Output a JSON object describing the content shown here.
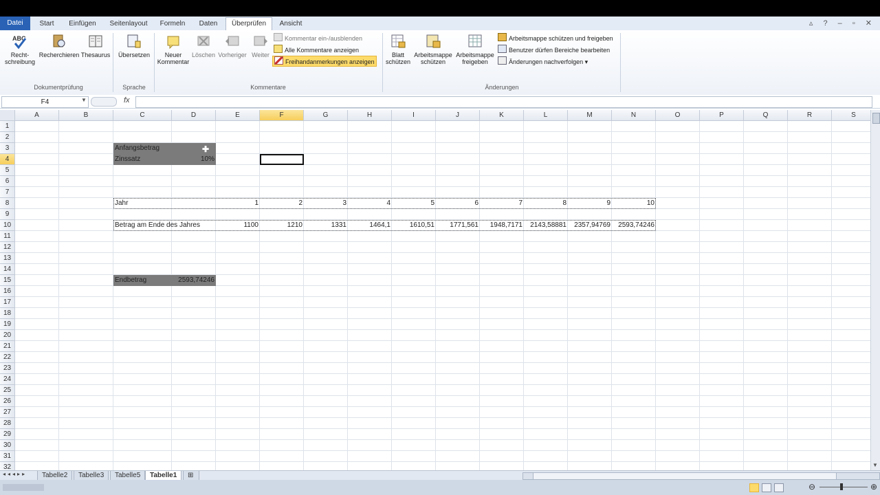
{
  "tabs": [
    "Datei",
    "Start",
    "Einfügen",
    "Seitenlayout",
    "Formeln",
    "Daten",
    "Überprüfen",
    "Ansicht"
  ],
  "ribbon": {
    "proof": {
      "spell": "Recht-\nschreibung",
      "research": "Recherchieren",
      "thesaurus": "Thesaurus",
      "group": "Dokumentprüfung"
    },
    "language": {
      "translate": "Übersetzen",
      "group": "Sprache"
    },
    "comments": {
      "new": "Neuer\nKommentar",
      "delete": "Löschen",
      "prev": "Vorheriger",
      "next": "Weiter",
      "toggle": "Kommentar ein-/ausblenden",
      "showall": "Alle Kommentare anzeigen",
      "ink": "Freihandanmerkungen anzeigen",
      "group": "Kommentare"
    },
    "changes": {
      "protect_sheet": "Blatt\nschützen",
      "protect_wb": "Arbeitsmappe\nschützen",
      "share_wb": "Arbeitsmappe\nfreigeben",
      "protect_share": "Arbeitsmappe schützen und freigeben",
      "allow_ranges": "Benutzer dürfen Bereiche bearbeiten",
      "track": "Änderungen nachverfolgen ▾",
      "group": "Änderungen"
    }
  },
  "formula": {
    "namebox": "F4",
    "fx": "fx",
    "value": ""
  },
  "columns": [
    "A",
    "B",
    "C",
    "D",
    "E",
    "F",
    "G",
    "H",
    "I",
    "J",
    "K",
    "L",
    "M",
    "N",
    "O",
    "P",
    "Q",
    "R",
    "S"
  ],
  "rows": [
    "1",
    "2",
    "3",
    "4",
    "5",
    "6",
    "7",
    "8",
    "9",
    "10",
    "11",
    "12",
    "13",
    "14",
    "15",
    "16",
    "17",
    "18",
    "19",
    "20",
    "21",
    "22",
    "23",
    "24",
    "25",
    "26",
    "27",
    "28",
    "29",
    "30",
    "31",
    "32"
  ],
  "cells": {
    "c3": "Anfangsbetrag",
    "d3": "",
    "c4": "Zinssatz",
    "d4": "10%",
    "c8": "Jahr",
    "years": [
      "1",
      "2",
      "3",
      "4",
      "5",
      "6",
      "7",
      "8",
      "9",
      "10"
    ],
    "c10": "Betrag am Ende des Jahres",
    "amounts": [
      "1100",
      "1210",
      "1331",
      "1464,1",
      "1610,51",
      "1771,561",
      "1948,7171",
      "2143,58881",
      "2357,94769",
      "2593,74246"
    ],
    "c15": "Endbetrag",
    "d15": "2593,74246"
  },
  "sheets": [
    "Tabelle2",
    "Tabelle3",
    "Tabelle5",
    "Tabelle1"
  ],
  "active_sheet": "Tabelle1",
  "colors": {
    "selection_header": "#f7cf5c",
    "dark_fill": "#7b7b7b",
    "file_tab": "#2a63b6",
    "highlight": "#fddb6a"
  }
}
